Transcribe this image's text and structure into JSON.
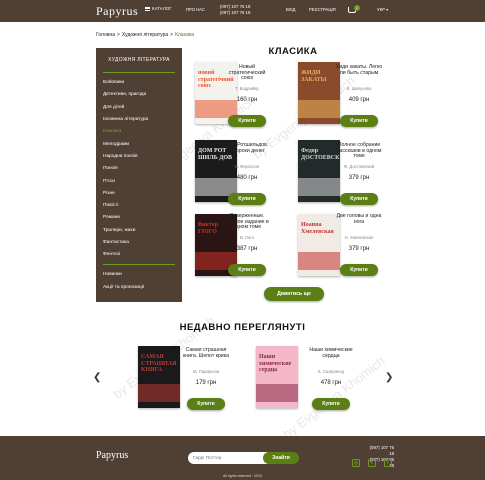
{
  "header": {
    "logo": "Papyrus",
    "catalog": "КАТАЛОГ",
    "about": "ПРО НАС",
    "phone1": "(097) 107 76 18",
    "phone2": "(097) 107 76 18",
    "login": "ВХІД",
    "register": "РЕЄСТРАЦІЯ",
    "cart_count": "1",
    "lang": "УКР"
  },
  "breadcrumb": {
    "home": "Головна",
    "sep1": ">",
    "section": "Художня лiтература",
    "sep2": ">",
    "current": "Класика"
  },
  "sidebar": {
    "title": "ХУДОЖНЯ ЛIТЕРАТУРА",
    "items": [
      "Бойовики",
      "Детективи, пригоди",
      "Для дітей",
      "Іноземна лiтература",
      "Класика",
      "Мелодрами",
      "Народна поезія",
      "Поезія",
      "П'єси",
      "Різне",
      "Повісті",
      "Романи",
      "Трилери, жахи",
      "Фантастика",
      "Фентезі"
    ],
    "extra": [
      "Новинки",
      "Акції та пропозиції"
    ]
  },
  "main": {
    "heading": "КЛАСИКА",
    "buy_label": "Купити",
    "more_label": "Дивитись ще",
    "books": [
      {
        "title": "Новый стратегический союз",
        "author": "Т. Бодрийяр",
        "price": "160 грн",
        "cover_title": "новий стратегічний союз",
        "cover_bg": "#f4f2ee",
        "cover_accent": "#e8552c"
      },
      {
        "title": "Хиди закаты. Легко ли быть старым",
        "author": "Е. Шипунова",
        "price": "409 грн",
        "cover_title": "ЖИДИ ЗАКАТЫ",
        "cover_bg": "#8a4a2c",
        "cover_accent": "#e6b35a"
      },
      {
        "title": "Дом Ротшильдов. Пророки денег",
        "author": "Н. Фергюсон",
        "price": "480 грн",
        "cover_title": "ДОМ РОТ ШИЛЬ ДОВ",
        "cover_bg": "#1b1b1b",
        "cover_accent": "#e8e8e8"
      },
      {
        "title": "Полное собрание рассказов в одном томе",
        "author": "Ф. Достоевский",
        "price": "379 грн",
        "cover_title": "Федор ДОСТОЕВСКИЙ",
        "cover_bg": "#222a2a",
        "cover_accent": "#d6d6d6"
      },
      {
        "title": "Отверженные. Полное издание в одном томе",
        "author": "В. Гюго",
        "price": "387 грн",
        "cover_title": "Виктор ГЮГО",
        "cover_bg": "#2a1414",
        "cover_accent": "#c83028"
      },
      {
        "title": "Две головы и одна нога",
        "author": "Н. Хмелевская",
        "price": "379 грн",
        "cover_title": "Иоанна Хмелевская",
        "cover_bg": "#f0ebe4",
        "cover_accent": "#c63232"
      }
    ]
  },
  "recent": {
    "heading": "НЕДАВНО ПЕРЕГЛЯНУТІ",
    "books": [
      {
        "title": "Самая страшная книга. Шепот крика",
        "author": "М. Парфенов",
        "price": "179 грн",
        "cover_title": "САМАЯ СТРАШНАЯ КНИГА",
        "cover_bg": "#1a1a1a",
        "cover_accent": "#b93a32"
      },
      {
        "title": "Наши химические сердца",
        "author": "К. Сазерленд",
        "price": "478 грн",
        "cover_title": "Наши химические сердца",
        "cover_bg": "#f3b7c8",
        "cover_accent": "#8a2a4a"
      }
    ]
  },
  "footer": {
    "logo": "Papyrus",
    "search_placeholder": "Гаррі Поттер",
    "search_label": "Знайти",
    "phone1": "(097) 107 76 18",
    "phone2": "(097) 107 76 18",
    "copyright": "All rights reserved · 2019"
  },
  "watermark": "by Evgeniya Khomich",
  "colors": {
    "brown": "#503f33",
    "green": "#5b7f14"
  },
  "icons": [
    "menu-icon",
    "cart-icon",
    "chevron-left-icon",
    "chevron-right-icon",
    "instagram-icon",
    "twitter-icon",
    "facebook-icon"
  ]
}
